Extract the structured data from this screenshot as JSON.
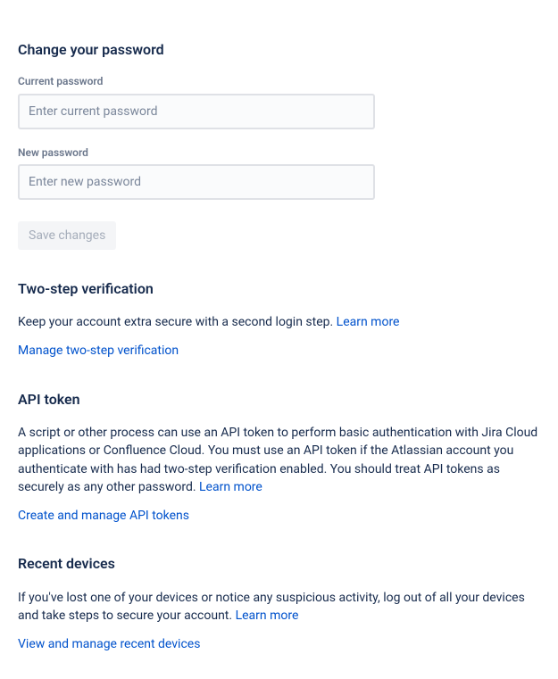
{
  "password_section": {
    "heading": "Change your password",
    "current_label": "Current password",
    "current_placeholder": "Enter current password",
    "new_label": "New password",
    "new_placeholder": "Enter new password",
    "save_button": "Save changes"
  },
  "twostep_section": {
    "heading": "Two-step verification",
    "description": "Keep your account extra secure with a second login step. ",
    "learn_more": "Learn more",
    "manage_link": "Manage two-step verification"
  },
  "api_section": {
    "heading": "API token",
    "description": "A script or other process can use an API token to perform basic authentication with Jira Cloud applications or Confluence Cloud. You must use an API token if the Atlassian account you authenticate with has had two-step verification enabled. You should treat API tokens as securely as any other password. ",
    "learn_more": "Learn more",
    "manage_link": "Create and manage API tokens"
  },
  "devices_section": {
    "heading": "Recent devices",
    "description": "If you've lost one of your devices or notice any suspicious activity, log out of all your devices and take steps to secure your account. ",
    "learn_more": "Learn more",
    "manage_link": "View and manage recent devices"
  }
}
